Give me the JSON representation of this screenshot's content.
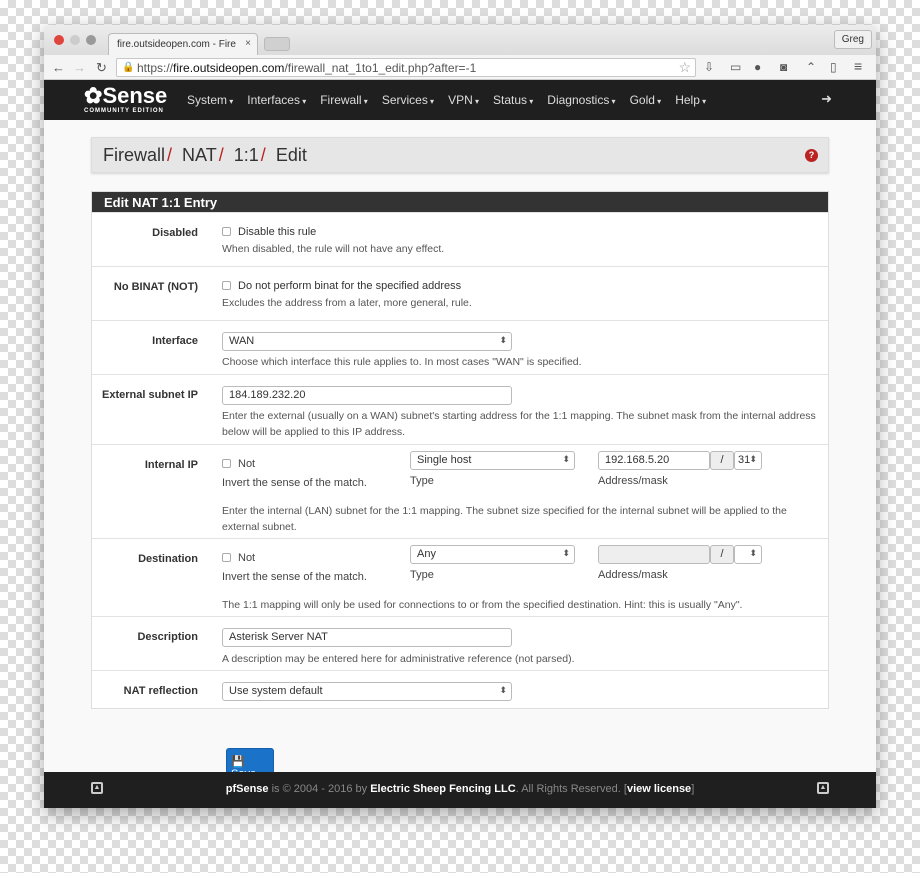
{
  "browser": {
    "tab_title": "fire.outsideopen.com - Fire",
    "user": "Greg",
    "url_scheme": "https://",
    "url_host": "fire.outsideopen.com",
    "url_path": "/firewall_nat_1to1_edit.php?after=-1"
  },
  "nav": {
    "logo": "Sense",
    "logo_sub": "COMMUNITY EDITION",
    "items": [
      "System",
      "Interfaces",
      "Firewall",
      "Services",
      "VPN",
      "Status",
      "Diagnostics",
      "Gold",
      "Help"
    ]
  },
  "breadcrumb": [
    "Firewall",
    "NAT",
    "1:1",
    "Edit"
  ],
  "panel_title": "Edit NAT 1:1 Entry",
  "form": {
    "disabled": {
      "label": "Disabled",
      "checkbox": "Disable this rule",
      "help": "When disabled, the rule will not have any effect."
    },
    "nobinat": {
      "label": "No BINAT (NOT)",
      "checkbox": "Do not perform binat for the specified address",
      "help": "Excludes the address from a later, more general, rule."
    },
    "interface": {
      "label": "Interface",
      "value": "WAN",
      "help": "Choose which interface this rule applies to. In most cases \"WAN\" is specified."
    },
    "external": {
      "label": "External subnet IP",
      "value": "184.189.232.20",
      "help": "Enter the external (usually on a WAN) subnet's starting address for the 1:1 mapping. The subnet mask from the internal address below will be applied to this IP address."
    },
    "internal": {
      "label": "Internal IP",
      "not": "Not",
      "not_help": "Invert the sense of the match.",
      "type": "Single host",
      "type_label": "Type",
      "address": "192.168.5.20",
      "slash": "/",
      "mask": "31",
      "address_label": "Address/mask",
      "help": "Enter the internal (LAN) subnet for the 1:1 mapping. The subnet size specified for the internal subnet will be applied to the external subnet."
    },
    "destination": {
      "label": "Destination",
      "not": "Not",
      "not_help": "Invert the sense of the match.",
      "type": "Any",
      "type_label": "Type",
      "address": "",
      "slash": "/",
      "mask": "",
      "address_label": "Address/mask",
      "help": "The 1:1 mapping will only be used for connections to or from the specified destination. Hint: this is usually \"Any\"."
    },
    "description": {
      "label": "Description",
      "value": "Asterisk Server NAT",
      "help": "A description may be entered here for administrative reference (not parsed)."
    },
    "reflection": {
      "label": "NAT reflection",
      "value": "Use system default"
    }
  },
  "save_label": "Save",
  "footer": {
    "brand": "pfSense",
    "text1": " is © 2004 - 2016 by ",
    "company": "Electric Sheep Fencing LLC",
    "text2": ". All Rights Reserved. [",
    "link": "view license",
    "text3": "]"
  },
  "colors": {
    "accent": "#b22222",
    "save": "#1a73c9",
    "navbar": "#1f1f1f"
  }
}
